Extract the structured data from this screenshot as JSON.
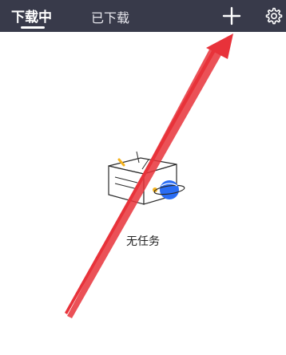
{
  "header": {
    "tabs": [
      {
        "label": "下载中",
        "active": true
      },
      {
        "label": "已下载",
        "active": false
      }
    ],
    "add_icon": "plus-icon",
    "settings_icon": "gear-icon",
    "background_color": "#383a4a"
  },
  "main": {
    "empty_state": {
      "illustration": "empty-box-planet-illustration",
      "label": "无任务"
    }
  },
  "overlay": {
    "annotation": "red-arrow-pointing-to-add-button",
    "color": "#e8323a"
  }
}
